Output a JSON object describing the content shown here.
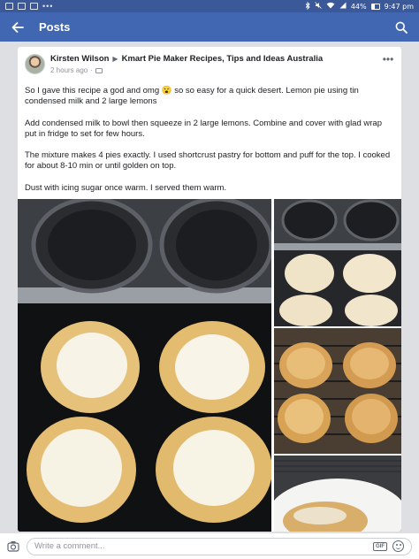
{
  "status_bar": {
    "battery": "44%",
    "time": "9:47 pm",
    "icons": [
      "facebook-notification-icon",
      "image-notification-icon",
      "email-notification-icon",
      "more-notifications-dots",
      "bluetooth-icon",
      "mute-icon",
      "wifi-icon",
      "cell-signal-icon",
      "battery-icon"
    ]
  },
  "app_bar": {
    "title": "Posts",
    "back_icon": "back-arrow-icon",
    "search_icon": "search-icon",
    "color": "#4267b2"
  },
  "post": {
    "author": "Kirsten Wilson",
    "group": "Kmart Pie Maker Recipes, Tips and Ideas Australia",
    "timestamp": "2 hours ago",
    "body": [
      "So I gave this recipe a god and omg 😮 so so easy for a quick desert. Lemon pie using tin condensed milk and 2 large lemons",
      "Add condensed milk to bowl then squeeze in 2 large lemons. Combine and cover with glad wrap put in fridge to set for few hours.",
      "The mixture makes 4 pies exactly. I used shortcrust pastry for bottom and puff for the top. I cooked for about 8-10 min or until golden on top.",
      "Dust with icing sugar once warm. I served them warm."
    ],
    "photos": [
      "pie-maker-with-lemon-filling-photo",
      "pie-maker-with-closed-pies-photo",
      "baked-pies-on-cooling-rack-photo",
      "pie-on-plate-photo"
    ]
  },
  "comment_bar": {
    "placeholder": "Write a comment...",
    "gif_label": "GIF"
  }
}
